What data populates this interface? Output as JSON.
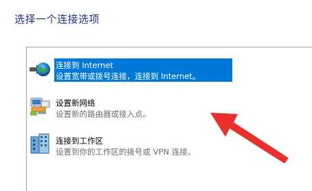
{
  "page": {
    "heading": "选择一个连接选项"
  },
  "options": [
    {
      "label": "连接到 Internet",
      "description": "设置宽带或拨号连接，连接到 Internet。",
      "icon": "globe-network-icon",
      "selected": true
    },
    {
      "label": "设置新网络",
      "description": "设置新的路由器或接入点。",
      "icon": "router-network-icon",
      "selected": false
    },
    {
      "label": "连接到工作区",
      "description": "设置到你的工作区的拨号或 VPN 连接。",
      "icon": "workplace-building-icon",
      "selected": false
    }
  ],
  "colors": {
    "heading": "#1e3287",
    "selection": "#0078d7",
    "annotation_arrow": "#e8312f"
  }
}
